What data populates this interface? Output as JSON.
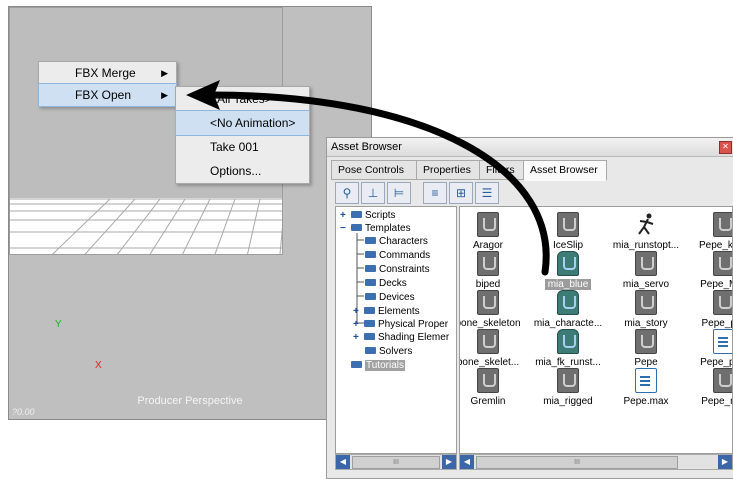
{
  "viewport": {
    "label": "Producer Perspective",
    "corner_text": "?0.00",
    "axis_x": "X",
    "axis_y": "Y"
  },
  "context_menu": {
    "items": [
      {
        "label": "FBX Merge",
        "has_submenu": true
      },
      {
        "label": "FBX Open",
        "has_submenu": true,
        "highlighted": true
      }
    ]
  },
  "submenu": {
    "items": [
      {
        "label": "<All Takes>"
      },
      {
        "label": "<No Animation>",
        "highlighted": true
      },
      {
        "label": "Take 001"
      },
      {
        "label": "Options..."
      }
    ]
  },
  "asset_browser": {
    "title": "Asset Browser",
    "close_glyph": "✕",
    "tabs": [
      {
        "label": "Pose Controls"
      },
      {
        "label": "Properties"
      },
      {
        "label": "Filters"
      },
      {
        "label": "Asset Browser",
        "active": true
      }
    ],
    "toolbar_icons": [
      "tree-view-icon",
      "list-align-icon",
      "indent-icon",
      "list-icon",
      "detail-icon",
      "tree-list-icon"
    ],
    "tree": [
      {
        "label": "Scripts",
        "expander": "+",
        "level": 0
      },
      {
        "label": "Templates",
        "expander": "−",
        "level": 0
      },
      {
        "label": "Characters",
        "level": 1
      },
      {
        "label": "Commands",
        "level": 1
      },
      {
        "label": "Constraints",
        "level": 1
      },
      {
        "label": "Decks",
        "level": 1
      },
      {
        "label": "Devices",
        "level": 1
      },
      {
        "label": "Elements",
        "expander": "+",
        "level": 1
      },
      {
        "label": "Physical Proper",
        "expander": "+",
        "level": 1
      },
      {
        "label": "Shading Elemer",
        "expander": "+",
        "level": 1
      },
      {
        "label": "Solvers",
        "level": 1
      },
      {
        "label": "Tutorials",
        "level": 0,
        "selected": true
      }
    ],
    "assets": [
      {
        "name": "Aragor",
        "icon": "template"
      },
      {
        "name": "IceSlip",
        "icon": "template"
      },
      {
        "name": "mia_runstopt...",
        "icon": "run"
      },
      {
        "name": "Pepe_keya",
        "icon": "template"
      },
      {
        "name": "biped",
        "icon": "template"
      },
      {
        "name": "mia_blue",
        "icon": "character",
        "selected": true
      },
      {
        "name": "mia_servo",
        "icon": "template"
      },
      {
        "name": "Pepe_Moc",
        "icon": "template"
      },
      {
        "name": "bone_skeleton",
        "icon": "template"
      },
      {
        "name": "mia_characte...",
        "icon": "character"
      },
      {
        "name": "mia_story",
        "icon": "template"
      },
      {
        "name": "Pepe_plot",
        "icon": "template"
      },
      {
        "name": "bone_skelet...",
        "icon": "template"
      },
      {
        "name": "mia_fk_runst...",
        "icon": "character"
      },
      {
        "name": "Pepe",
        "icon": "template"
      },
      {
        "name": "Pepe_plott",
        "icon": "document"
      },
      {
        "name": "Gremlin",
        "icon": "template"
      },
      {
        "name": "mia_rigged",
        "icon": "template"
      },
      {
        "name": "Pepe.max",
        "icon": "document"
      },
      {
        "name": "Pepe_rigg",
        "icon": "template"
      }
    ],
    "scroll": {
      "left": "◀",
      "right": "▶",
      "grip": "III"
    }
  },
  "colors": {
    "viewport_bg": "#bfbfbf",
    "menu_highlight": "#cfe0f3",
    "folder": "#3b6fb2",
    "arrow": "#000000"
  }
}
